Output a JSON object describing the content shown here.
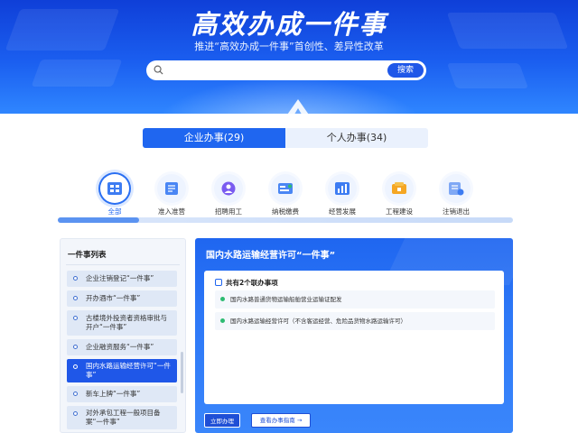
{
  "banner": {
    "title": "高效办成一件事",
    "subtitle": "推进“高效办成一件事”首创性、差异性改革"
  },
  "search": {
    "value": "",
    "placeholder": "",
    "button_label": "搜索"
  },
  "tabs": [
    {
      "label": "企业办事(29)",
      "active": true
    },
    {
      "label": "个人办事(34)",
      "active": false
    }
  ],
  "categories": [
    {
      "label": "全部",
      "icon": "all-icon",
      "active": true
    },
    {
      "label": "准入准营",
      "icon": "license-icon",
      "active": false
    },
    {
      "label": "招聘用工",
      "icon": "person-icon",
      "active": false
    },
    {
      "label": "纳税缴费",
      "icon": "tax-icon",
      "active": false
    },
    {
      "label": "经营发展",
      "icon": "chart-icon",
      "active": false
    },
    {
      "label": "工程建设",
      "icon": "construction-icon",
      "active": false
    },
    {
      "label": "注销退出",
      "icon": "cancel-icon",
      "active": false
    }
  ],
  "list": {
    "title": "一件事列表",
    "items": [
      {
        "label": "企业注销登记“一件事”",
        "selected": false
      },
      {
        "label": "开办酒市“一件事”",
        "selected": false
      },
      {
        "label": "古楼境外投资者资格审批与开户“一件事”",
        "selected": false
      },
      {
        "label": "企业融资服务“一件事”",
        "selected": false
      },
      {
        "label": "国内水路运输经营许可“一件事”",
        "selected": true
      },
      {
        "label": "新车上牌“一件事”",
        "selected": false
      },
      {
        "label": "对外承包工程一般项目备案“一件事”",
        "selected": false
      }
    ]
  },
  "detail": {
    "title": "国内水路运输经营许可“一件事”",
    "count_label": "共有2个联办事项",
    "items": [
      "国内水路普通货物运输船舶营业运输证配发",
      "国内水路运输经营许可（不含客运经营、危险品货物水路运输许可）"
    ],
    "primary_button": "立即办理",
    "secondary_button": "查看办事指南"
  },
  "colors": {
    "brand": "#1f66f0",
    "banner_dark": "#0f3fd8",
    "success": "#2dbb72"
  }
}
